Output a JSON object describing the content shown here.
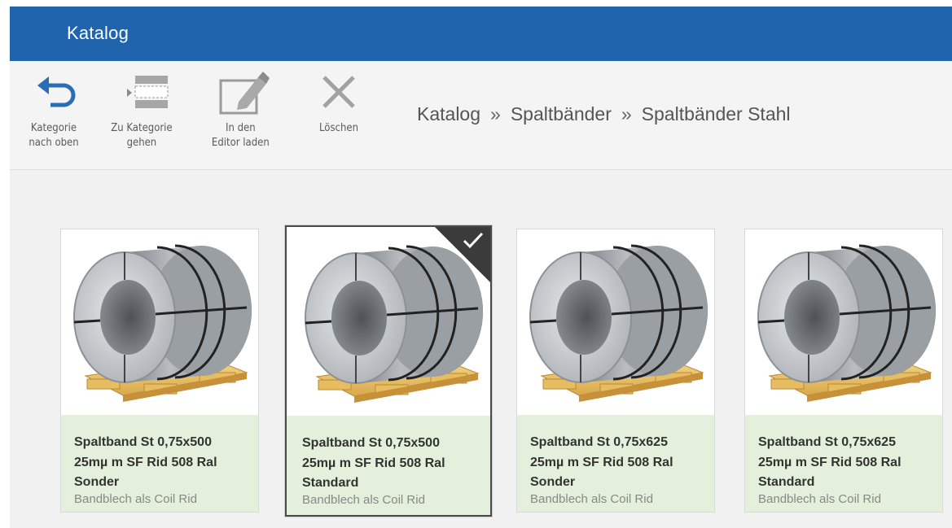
{
  "window": {
    "title": "Katalog"
  },
  "toolbar": {
    "up": {
      "line1": "Kategorie",
      "line2": "nach oben",
      "icon": "arrow-back-icon"
    },
    "goto": {
      "line1": "Zu Kategorie",
      "line2": "gehen",
      "icon": "goto-category-icon"
    },
    "editor": {
      "line1": "In den",
      "line2": "Editor laden",
      "icon": "pencil-icon"
    },
    "delete": {
      "line1": "Löschen",
      "icon": "close-icon"
    }
  },
  "breadcrumb": {
    "items": [
      "Katalog",
      "Spaltbänder",
      "Spaltbänder Stahl"
    ],
    "separator": "»"
  },
  "cards": [
    {
      "line1": "Spaltband St 0,75x500",
      "line2": "25mµ m SF Rid 508 Ral",
      "line3": "Sonder",
      "sub": "Bandblech als Coil  Rid",
      "selected": false
    },
    {
      "line1": "Spaltband St 0,75x500",
      "line2": "25mµ m SF Rid 508 Ral",
      "line3": "Standard",
      "sub": "Bandblech als Coil  Rid",
      "selected": true
    },
    {
      "line1": "Spaltband St 0,75x625",
      "line2": "25mµ m SF Rid 508 Ral",
      "line3": "Sonder",
      "sub": "Bandblech als Coil  Rid",
      "selected": false
    },
    {
      "line1": "Spaltband St 0,75x625",
      "line2": "25mµ m SF Rid 508 Ral",
      "line3": "Standard",
      "sub": "Bandblech als Coil  Rid",
      "selected": false
    }
  ],
  "colors": {
    "titlebar": "#1f64ad",
    "card_info": "#e4f0db",
    "accent_icon": "#2a6db5"
  }
}
